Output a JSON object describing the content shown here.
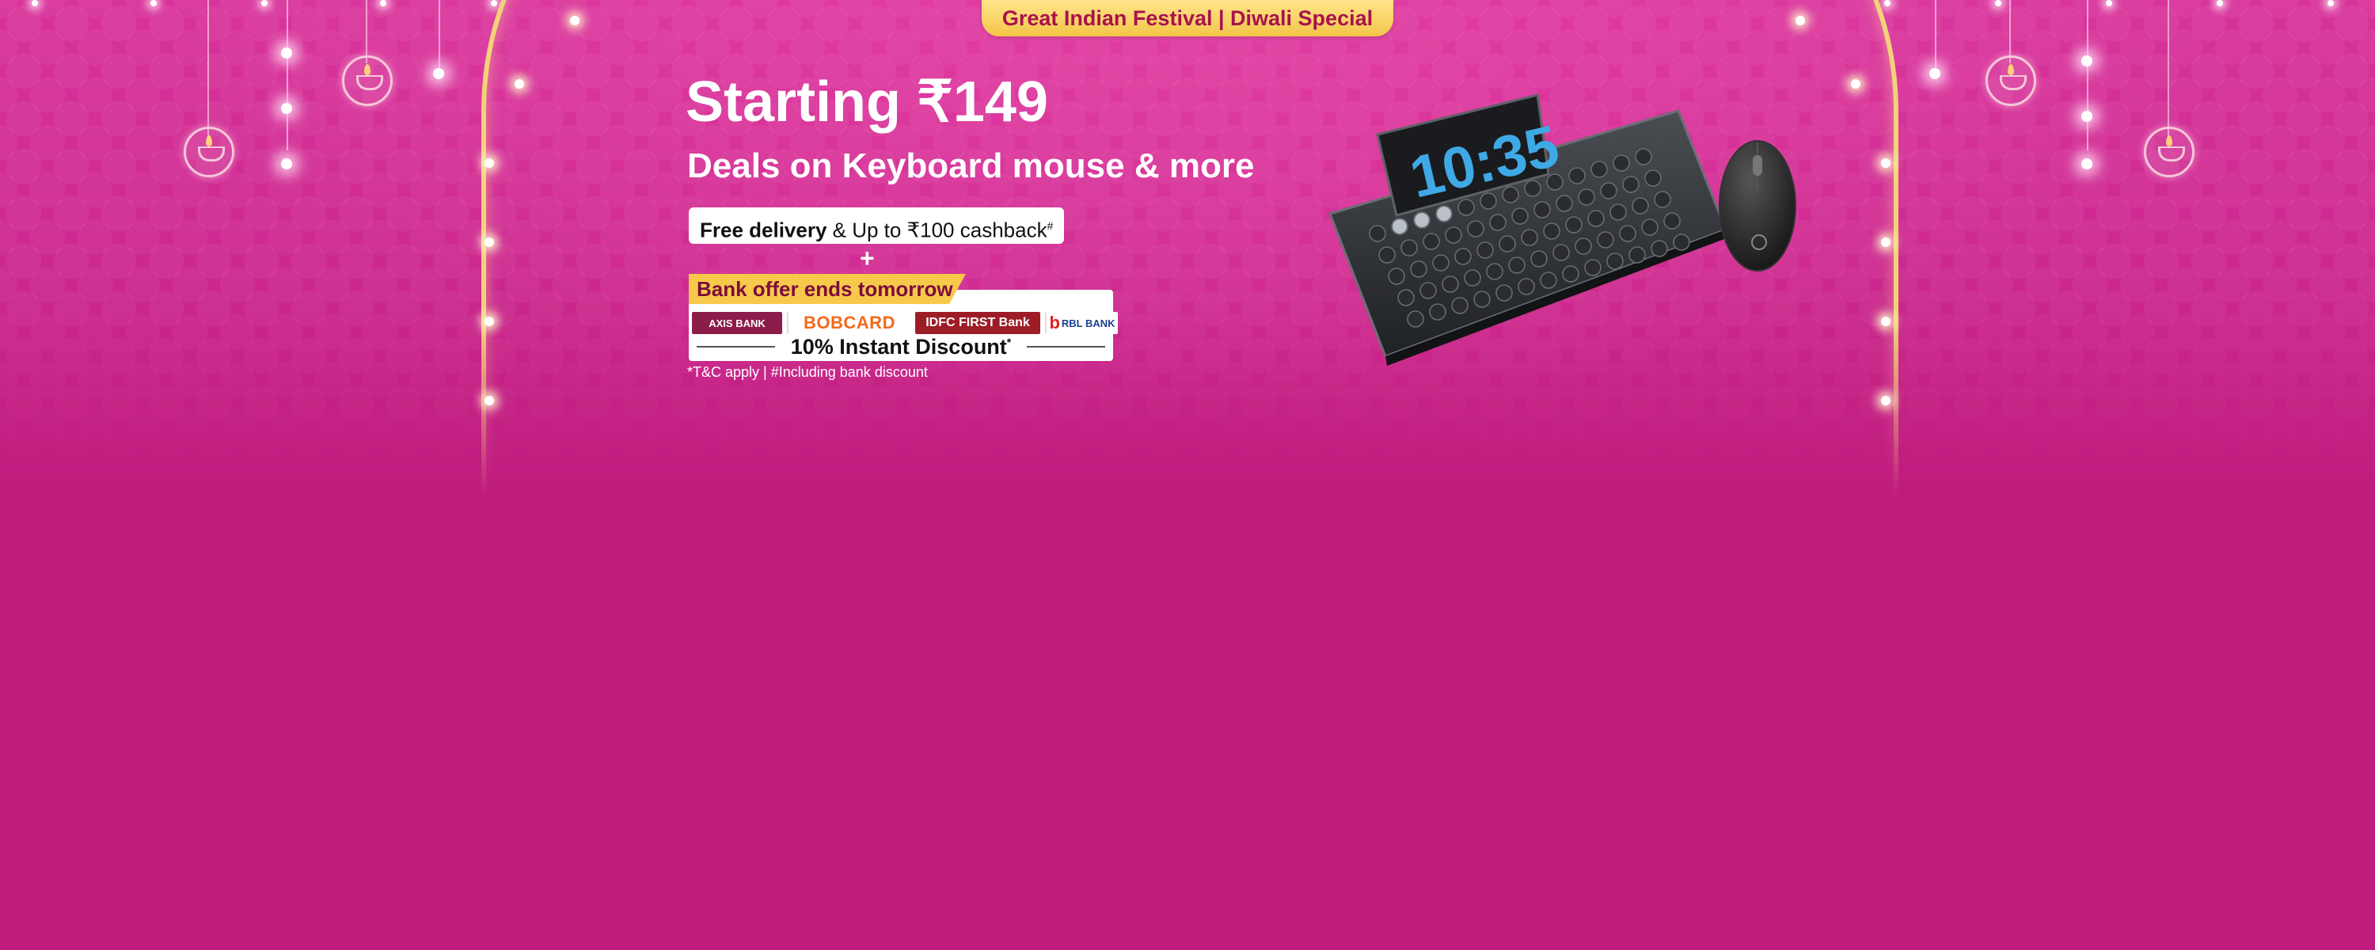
{
  "banner": {
    "festival_tag": "Great Indian Festival | Diwali Special",
    "title": "Starting ₹149",
    "subtitle": "Deals on Keyboard mouse & more",
    "delivery_bold": "Free delivery",
    "delivery_rest": " & Up to ₹100 cashback",
    "delivery_mark": "#",
    "plus": "+",
    "bank_offer_tag": "Bank offer ends tomorrow",
    "banks": {
      "axis": "AXIS BANK",
      "bob": "BOBCARD",
      "idfc": "IDFC FIRST Bank",
      "rbl_mark": "b",
      "rbl": "RBL BANK"
    },
    "discount": "10% Instant Discount",
    "discount_mark": "*",
    "tnc": "*T&C apply | #Including bank discount"
  },
  "product": {
    "clock_time": "10:35"
  },
  "colors": {
    "background": "#c01c7e",
    "gold": "#f3c548",
    "tag_text": "#a8124e"
  }
}
